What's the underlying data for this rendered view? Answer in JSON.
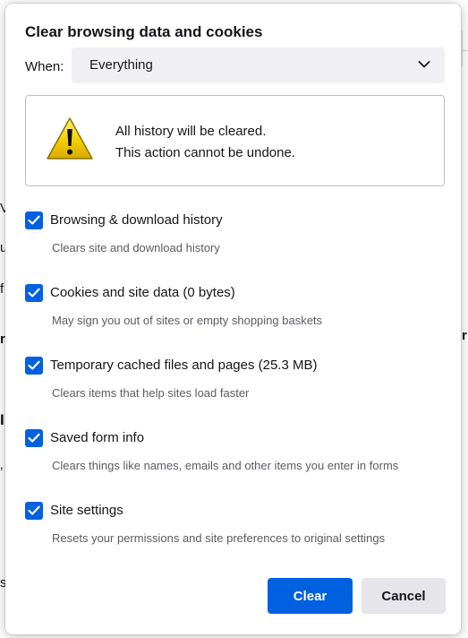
{
  "background_fragments": [
    "V",
    "u",
    "f",
    "r",
    "I",
    "‚",
    "s",
    "r"
  ],
  "dialog": {
    "title": "Clear browsing data and cookies",
    "when_label": "When:",
    "when_value": "Everything",
    "warning_line1": "All history will be cleared.",
    "warning_line2": "This action cannot be undone."
  },
  "options": [
    {
      "label": "Browsing & download history",
      "desc": "Clears site and download history",
      "checked": true
    },
    {
      "label": "Cookies and site data (0 bytes)",
      "desc": "May sign you out of sites or empty shopping baskets",
      "checked": true
    },
    {
      "label": "Temporary cached files and pages (25.3 MB)",
      "desc": "Clears items that help sites load faster",
      "checked": true
    },
    {
      "label": "Saved form info",
      "desc": "Clears things like names, emails and other items you enter in forms",
      "checked": true
    },
    {
      "label": "Site settings",
      "desc": "Resets your permissions and site preferences to original settings",
      "checked": true
    }
  ],
  "buttons": {
    "clear": "Clear",
    "cancel": "Cancel"
  },
  "colors": {
    "accent": "#0061e0",
    "select_bg": "#f0f0f4",
    "cancel_bg": "#e5e5ea",
    "desc_text": "#5b5b66"
  },
  "icons": {
    "warning": "warning-triangle-icon",
    "chevron": "chevron-down-icon",
    "check": "checkmark-icon"
  }
}
